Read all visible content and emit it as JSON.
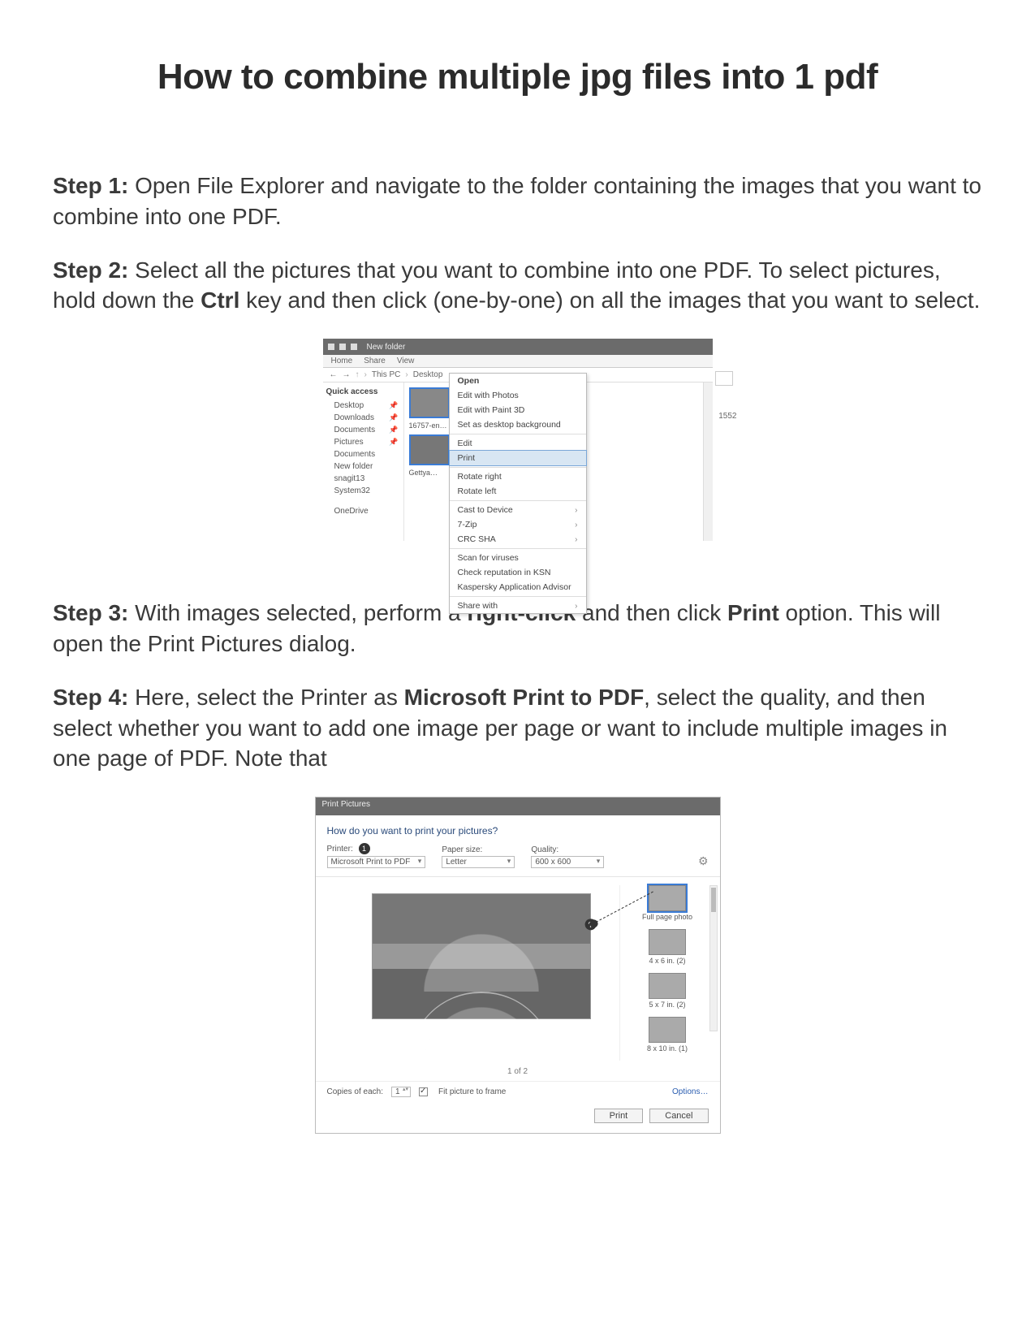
{
  "title": "How to combine multiple jpg files into 1 pdf",
  "steps": {
    "s1_label": "Step 1:",
    "s1_text": " Open File Explorer and navigate to the folder containing the images that you want to combine into one PDF.",
    "s2_label": "Step 2:",
    "s2_text_a": " Select all the pictures that you want to combine into one PDF. To select pictures, hold down the ",
    "s2_bold": "Ctrl",
    "s2_text_b": " key and then click (one-by-one) on all the images that you want to select.",
    "s3_label": "Step 3:",
    "s3_text_a": " With images selected, perform a ",
    "s3_bold_a": "right-click",
    "s3_text_b": " and then click ",
    "s3_bold_b": "Print",
    "s3_text_c": " option. This will open the Print Pictures dialog.",
    "s4_label": "Step 4:",
    "s4_text_a": " Here, select the Printer as ",
    "s4_bold": "Microsoft Print to PDF",
    "s4_text_b": ", select the quality, and then select whether you want to add one image per page or want to include multiple images in one page of PDF. Note that"
  },
  "explorer": {
    "window_title": "New folder",
    "ribbon": {
      "home": "Home",
      "share": "Share",
      "view": "View"
    },
    "breadcrumb": {
      "pc": "This PC",
      "loc": "Desktop"
    },
    "nav": {
      "quick": "Quick access",
      "desktop": "Desktop",
      "downloads": "Downloads",
      "documents": "Documents",
      "pictures": "Pictures",
      "documents2": "Documents",
      "newfolder": "New folder",
      "snagit": "snagit13",
      "system32": "System32",
      "onedrive": "OneDrive"
    },
    "thumbs": {
      "name1": "16757-en…",
      "name2": "Gettya…"
    },
    "search_year": "1552",
    "ctx": {
      "open": "Open",
      "edit_photos": "Edit with Photos",
      "edit_paint3d": "Edit with Paint 3D",
      "set_bg": "Set as desktop background",
      "edit": "Edit",
      "print": "Print",
      "rot_r": "Rotate right",
      "rot_l": "Rotate left",
      "cast": "Cast to Device",
      "zip": "7-Zip",
      "crc": "CRC SHA",
      "scan": "Scan for viruses",
      "ksn": "Check reputation in KSN",
      "kav": "Kaspersky Application Advisor",
      "share": "Share with"
    }
  },
  "print": {
    "window_title": "Print Pictures",
    "prompt": "How do you want to print your pictures?",
    "printer_label": "Printer:",
    "printer_value": "Microsoft Print to PDF",
    "paper_label": "Paper size:",
    "paper_value": "Letter",
    "quality_label": "Quality:",
    "quality_value": "600 x 600",
    "mark1": "1",
    "mark2": "2",
    "layouts": {
      "full": "Full page photo",
      "l4x6": "4 x 6 in. (2)",
      "l5x7": "5 x 7 in. (2)",
      "l8x10": "8 x 10 in. (1)"
    },
    "page_of": "1 of 2",
    "copies_label": "Copies of each:",
    "copies_value": "1",
    "fit_label": "Fit picture to frame",
    "options_link": "Options…",
    "btn_print": "Print",
    "btn_cancel": "Cancel"
  }
}
